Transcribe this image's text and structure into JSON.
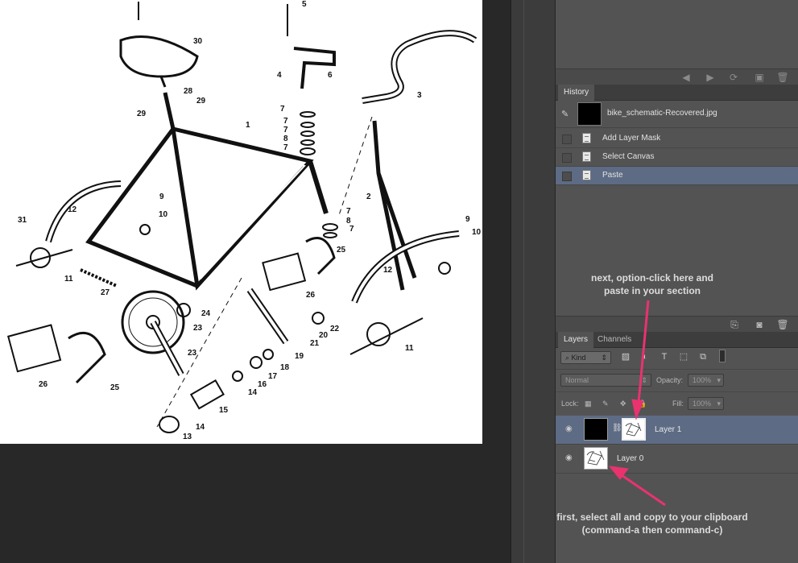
{
  "canvas": {
    "image_label": "bike schematic drawing",
    "part_numbers": [
      "5",
      "30",
      "3",
      "6",
      "4",
      "28",
      "29",
      "29",
      "1",
      "7",
      "7",
      "7",
      "8",
      "7",
      "9",
      "10",
      "12",
      "2",
      "7",
      "8",
      "7",
      "9",
      "10",
      "31",
      "11",
      "25",
      "27",
      "26",
      "21",
      "24",
      "23",
      "22",
      "20",
      "19",
      "12",
      "11",
      "18",
      "17",
      "16",
      "14",
      "23",
      "26",
      "25",
      "15",
      "14",
      "13"
    ]
  },
  "top_toolbar": {
    "icons": [
      "prev-icon",
      "next-icon",
      "refresh-icon",
      "new-page-icon",
      "trash-icon"
    ]
  },
  "history": {
    "tabs": [
      "History"
    ],
    "snapshot_label": "bike_schematic-Recovered.jpg",
    "items": [
      {
        "label": "Add Layer Mask",
        "selected": false
      },
      {
        "label": "Select Canvas",
        "selected": false
      },
      {
        "label": "Paste",
        "selected": true
      }
    ]
  },
  "layers": {
    "tabs": [
      "Layers",
      "Channels"
    ],
    "filter_kind": "Kind",
    "blend_mode": "Normal",
    "opacity_label": "Opacity:",
    "opacity_value": "100%",
    "lock_label": "Lock:",
    "fill_label": "Fill:",
    "fill_value": "100%",
    "items": [
      {
        "name": "Layer 1",
        "selected": true
      },
      {
        "name": "Layer 0",
        "selected": false
      }
    ]
  },
  "annotations": {
    "top_line1": "next, option-click here and",
    "top_line2": "paste in your section",
    "bottom_line1": "first, select all and copy to your clipboard",
    "bottom_line2": "(command-a then command-c)"
  },
  "colors": {
    "accent_arrow": "#e8336f",
    "selection": "#5d6b84",
    "panel_bg": "#535353"
  }
}
